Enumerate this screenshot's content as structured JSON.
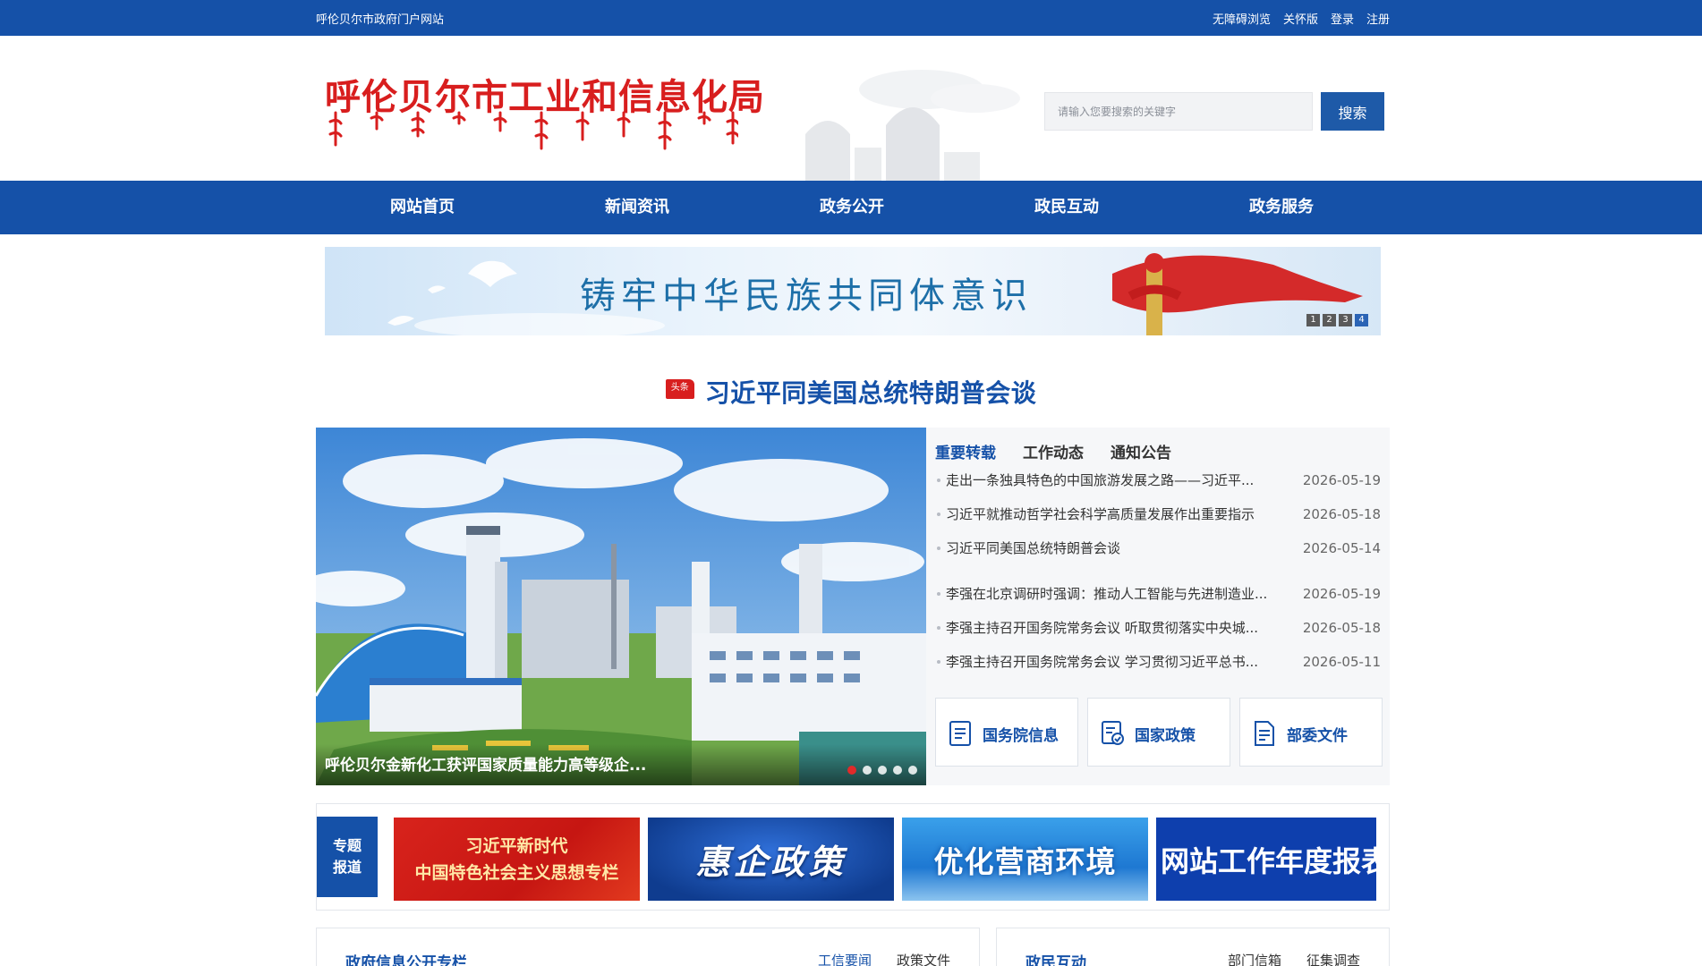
{
  "topbar": {
    "site_name": "呼伦贝尔市政府门户网站",
    "links": [
      "无障碍浏览",
      "关怀版",
      "登录",
      "注册"
    ]
  },
  "header": {
    "title": "呼伦贝尔市工业和信息化局",
    "search_placeholder": "请输入您要搜索的关键字",
    "search_button": "搜索"
  },
  "nav": {
    "items": [
      "网站首页",
      "新闻资讯",
      "政务公开",
      "政民互动",
      "政务服务"
    ]
  },
  "banner": {
    "slogan": "铸牢中华民族共同体意识",
    "pages": [
      "1",
      "2",
      "3",
      "4"
    ],
    "active_page": 4
  },
  "headline": {
    "badge": "头条",
    "title": "习近平同美国总统特朗普会谈"
  },
  "photo": {
    "caption": "呼伦贝尔金新化工获评国家质量能力高等级企..."
  },
  "tabs": {
    "items": [
      "重要转载",
      "工作动态",
      "通知公告"
    ],
    "active": "重要转载"
  },
  "news": [
    {
      "title": "走出一条独具特色的中国旅游发展之路——习近平...",
      "date": "2026-05-19"
    },
    {
      "title": "习近平就推动哲学社会科学高质量发展作出重要指示",
      "date": "2026-05-18"
    },
    {
      "title": "习近平同美国总统特朗普会谈",
      "date": "2026-05-14"
    },
    {
      "title": "李强在北京调研时强调：推动人工智能与先进制造业...",
      "date": "2026-05-19"
    },
    {
      "title": "李强主持召开国务院常务会议 听取贯彻落实中央城...",
      "date": "2026-05-18"
    },
    {
      "title": "李强主持召开国务院常务会议 学习贯彻习近平总书...",
      "date": "2026-05-11"
    }
  ],
  "quick_links": [
    {
      "label": "国务院信息",
      "icon": "document-list-icon"
    },
    {
      "label": "国家政策",
      "icon": "policy-badge-icon"
    },
    {
      "label": "部委文件",
      "icon": "file-icon"
    }
  ],
  "topics": {
    "label_line1": "专题",
    "label_line2": "报道",
    "tiles": [
      {
        "line1": "习近平新时代",
        "line2": "中国特色社会主义思想专栏"
      },
      {
        "text": "惠企政策"
      },
      {
        "text": "优化营商环境"
      },
      {
        "text": "网站工作年度报表"
      }
    ]
  },
  "panels": {
    "left": {
      "title": "政府信息公开专栏",
      "tabs": [
        "工信要闻",
        "政策文件"
      ]
    },
    "right": {
      "title": "政民互动",
      "tabs": [
        "部门信箱",
        "征集调查"
      ]
    }
  },
  "colors": {
    "brand_blue": "#1551a8",
    "logo_red": "#d81e1e"
  }
}
